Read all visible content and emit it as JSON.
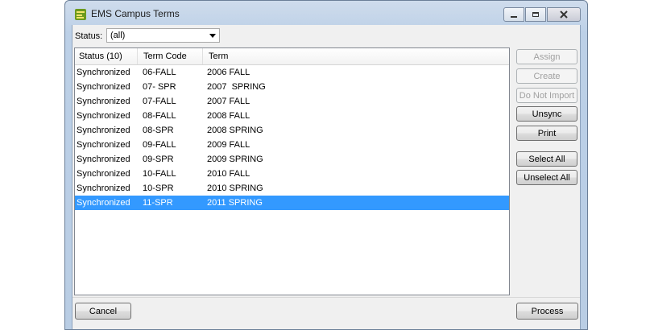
{
  "window": {
    "title": "EMS Campus Terms"
  },
  "filter": {
    "label": "Status:",
    "value": "(all)"
  },
  "list": {
    "columns": [
      "Status (10)",
      "Term Code",
      "Term"
    ],
    "rows": [
      {
        "status": "Synchronized",
        "code": "06-FALL",
        "term": "2006 FALL"
      },
      {
        "status": "Synchronized",
        "code": "07- SPR",
        "term": "2007  SPRING"
      },
      {
        "status": "Synchronized",
        "code": "07-FALL",
        "term": "2007 FALL"
      },
      {
        "status": "Synchronized",
        "code": "08-FALL",
        "term": "2008 FALL"
      },
      {
        "status": "Synchronized",
        "code": "08-SPR",
        "term": "2008 SPRING"
      },
      {
        "status": "Synchronized",
        "code": "09-FALL",
        "term": "2009 FALL"
      },
      {
        "status": "Synchronized",
        "code": "09-SPR",
        "term": "2009 SPRING"
      },
      {
        "status": "Synchronized",
        "code": "10-FALL",
        "term": "2010 FALL"
      },
      {
        "status": "Synchronized",
        "code": "10-SPR",
        "term": "2010 SPRING"
      },
      {
        "status": "Synchronized",
        "code": "11-SPR",
        "term": "2011 SPRING"
      }
    ],
    "selected_row": 9
  },
  "actions": {
    "assign": "Assign",
    "create": "Create",
    "do_not_import": "Do Not Import",
    "unsync": "Unsync",
    "print": "Print",
    "select_all": "Select All",
    "unselect_all": "Unselect All"
  },
  "footer": {
    "cancel": "Cancel",
    "process": "Process"
  },
  "colors": {
    "selection": "#3399ff",
    "disabled_text": "#a0a0a0"
  }
}
